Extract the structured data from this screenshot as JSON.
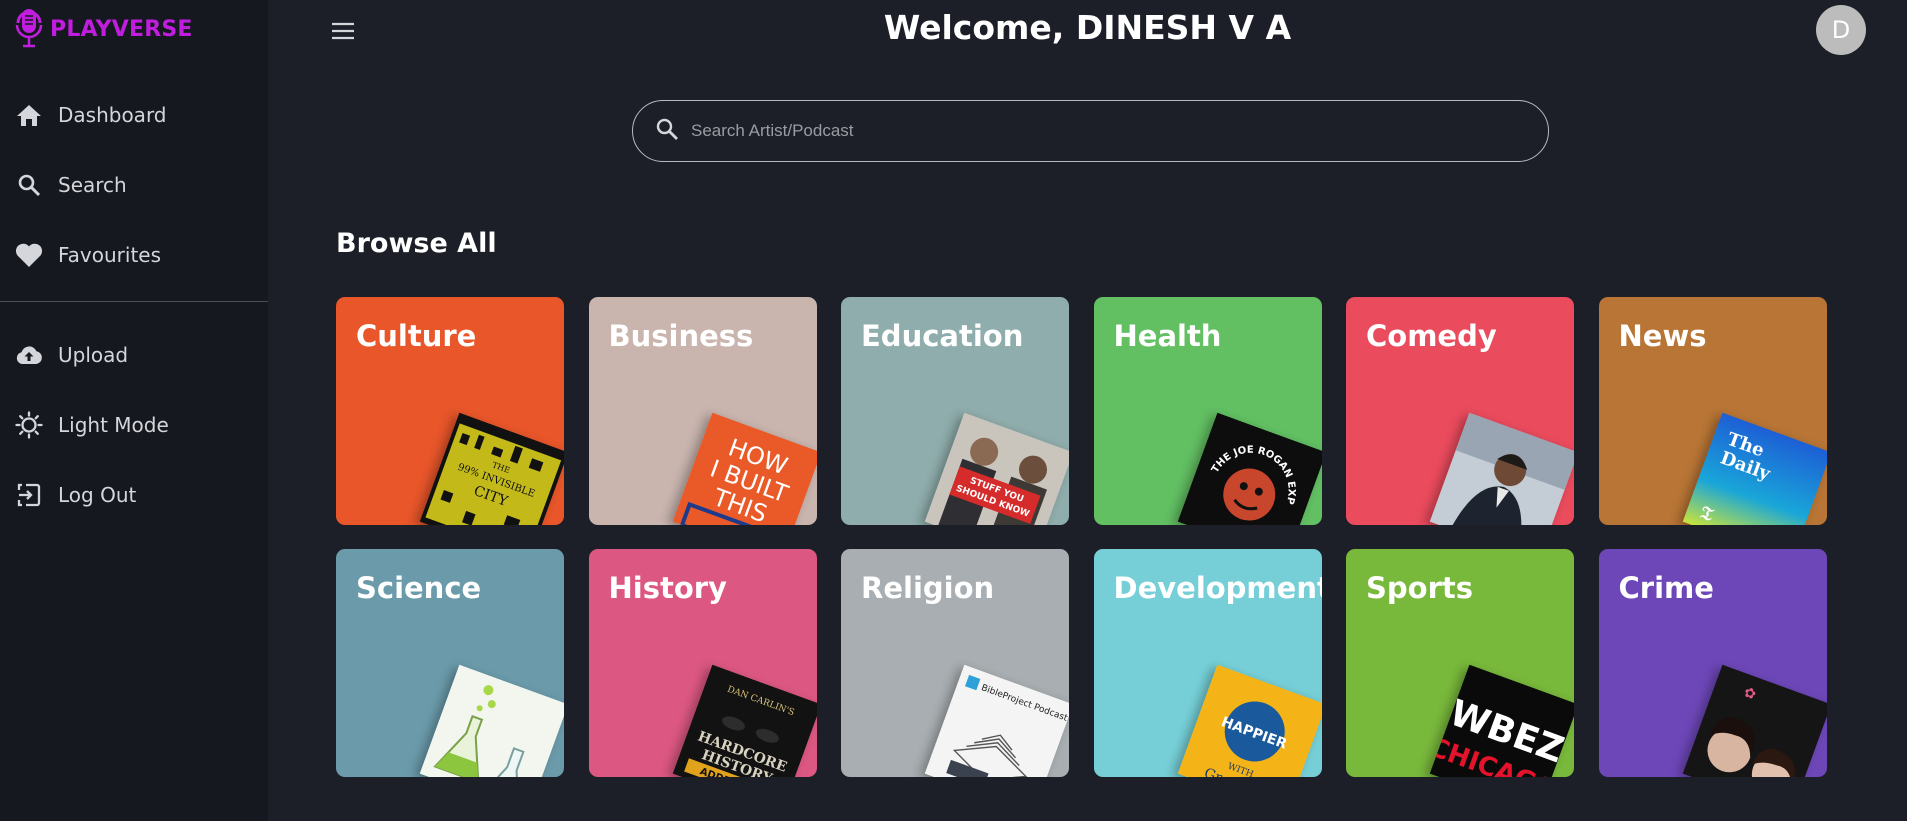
{
  "app": {
    "name": "PLAYVERSE",
    "brand_color": "#c01ddf"
  },
  "sidebar": {
    "items": [
      {
        "label": "Dashboard",
        "icon": "home-icon"
      },
      {
        "label": "Search",
        "icon": "search-icon"
      },
      {
        "label": "Favourites",
        "icon": "heart-icon"
      },
      {
        "label": "Upload",
        "icon": "cloud-upload-icon"
      },
      {
        "label": "Light Mode",
        "icon": "sun-icon"
      },
      {
        "label": "Log Out",
        "icon": "logout-icon"
      }
    ]
  },
  "header": {
    "welcome": "Welcome, DINESH V A",
    "avatar_initial": "D"
  },
  "search": {
    "placeholder": "Search Artist/Podcast"
  },
  "browse": {
    "title": "Browse All",
    "categories": [
      {
        "label": "Culture",
        "color": "#e8562a"
      },
      {
        "label": "Business",
        "color": "#c9b4ae"
      },
      {
        "label": "Education",
        "color": "#8fadac"
      },
      {
        "label": "Health",
        "color": "#62bf62"
      },
      {
        "label": "Comedy",
        "color": "#ea4b5d"
      },
      {
        "label": "News",
        "color": "#b87535"
      },
      {
        "label": "Science",
        "color": "#6b9bab"
      },
      {
        "label": "History",
        "color": "#dc5882"
      },
      {
        "label": "Religion",
        "color": "#a8aeb1"
      },
      {
        "label": "Development",
        "color": "#76cfd7"
      },
      {
        "label": "Sports",
        "color": "#78b83b"
      },
      {
        "label": "Crime",
        "color": "#6d47b8"
      }
    ]
  },
  "artwork": {
    "culture": [
      "THE",
      "99% INVISIBLE",
      "CITY"
    ],
    "business": [
      "HOW",
      "I BUILT",
      "THIS"
    ],
    "education": [
      "STUFF YOU",
      "SHOULD KNOW"
    ],
    "health": "THE JOE ROGAN EXPE",
    "news": [
      "The",
      "Daily"
    ],
    "history": [
      "DAN CARLIN'S",
      "HARDCORE",
      "HISTORY",
      "ADDENDUM"
    ],
    "religion": "BibleProject Podcast",
    "development": [
      "HAPPIER",
      "WITH",
      "Gretchen"
    ],
    "sports": [
      "WBEZ",
      "CHICAGO"
    ]
  }
}
